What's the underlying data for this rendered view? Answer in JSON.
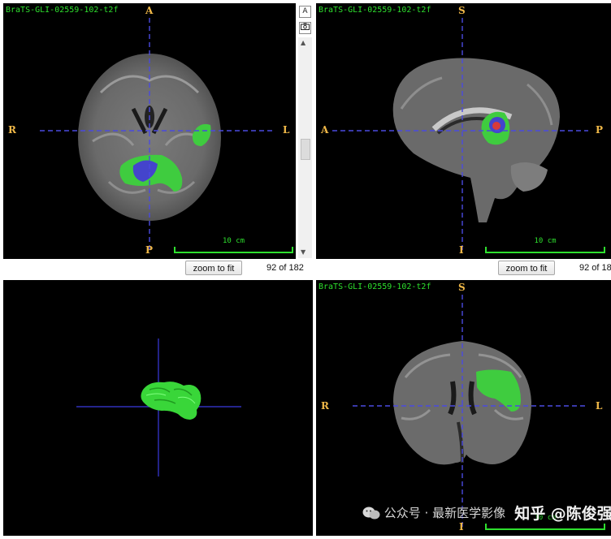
{
  "accent_color": "#2ee02e",
  "crosshair_color": "#4a4ae0",
  "label_color": "#f0b848",
  "views": {
    "axial": {
      "title": "BraTS-GLI-02559-102-t2f",
      "labels": {
        "top": "A",
        "bottom": "P",
        "left": "R",
        "right": "L"
      },
      "scale_label": "10 cm",
      "zoom_label": "zoom to fit",
      "slice_text": "92 of 182"
    },
    "sagittal": {
      "title": "BraTS-GLI-02559-102-t2f",
      "labels": {
        "top": "S",
        "bottom": "I",
        "left": "A",
        "right": "P"
      },
      "scale_label": "10 cm",
      "zoom_label": "zoom to fit",
      "slice_text": "92 of 18"
    },
    "render3d": {
      "name": "3D segmentation view"
    },
    "coronal": {
      "title": "BraTS-GLI-02559-102-t2f",
      "labels": {
        "top": "S",
        "bottom": "I",
        "left": "R",
        "right": "L"
      },
      "scale_label": "10 cm"
    }
  },
  "toolbar": {
    "annotate_icon": "A",
    "camera_icon": "camera-icon",
    "scroll_up_icon": "▲",
    "scroll_down_icon": "▼"
  },
  "watermark": {
    "wechat": "公众号 · 最新医学影像",
    "zhihu": "知乎 @陈俊强"
  }
}
